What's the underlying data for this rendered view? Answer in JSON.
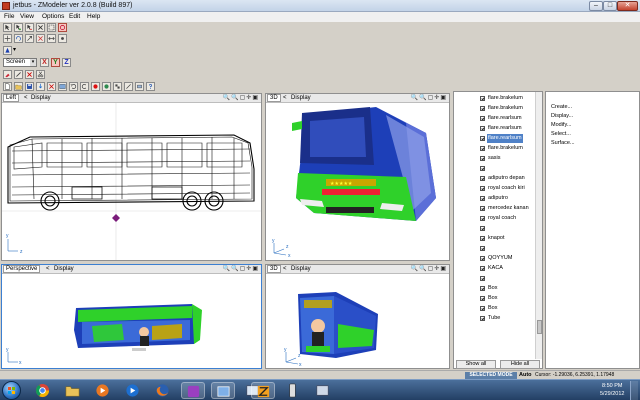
{
  "window": {
    "title": "jetbus - ZModeler ver 2.0.8 (Build 897)",
    "minimize": "–",
    "maximize": "□",
    "close": "✕"
  },
  "menu": [
    "File",
    "View",
    "Options",
    "Edit",
    "Help"
  ],
  "toolbar": {
    "screen_select": "Screen",
    "screen_arrow": "▾",
    "snap_arrow": "▾",
    "axis_labels": [
      "X",
      "Y",
      "Z"
    ]
  },
  "viewports": {
    "left": {
      "name": "Left",
      "mode": "Display",
      "tools": "🔍🔍▢✛▣"
    },
    "threed_top": {
      "name": "3D",
      "mode": "Display",
      "tools": "🔍🔍▢✛▣"
    },
    "perspective": {
      "name": "Perspective",
      "mode": "Display",
      "tools": "🔍🔍▢✛▣"
    },
    "threed_bottom": {
      "name": "3D",
      "mode": "Display",
      "tools": "🔍🔍▢✛▣"
    },
    "axes": {
      "y": "y",
      "z": "z",
      "x": "x"
    }
  },
  "objects": [
    {
      "label": "flare.brakelum"
    },
    {
      "label": "flare.brakelum"
    },
    {
      "label": "flare.rearlsum"
    },
    {
      "label": "flare.rearlsum"
    },
    {
      "label": "flare.rearlsum",
      "selected": true
    },
    {
      "label": "flare.brakelum"
    },
    {
      "label": "sasis"
    },
    {
      "label": ""
    },
    {
      "label": "adiputro depan"
    },
    {
      "label": "royal coach kiri"
    },
    {
      "label": "adiputro"
    },
    {
      "label": "mercedez kanan"
    },
    {
      "label": "royal coach"
    },
    {
      "label": ""
    },
    {
      "label": "knapot"
    },
    {
      "label": ""
    },
    {
      "label": "QOYYUM"
    },
    {
      "label": "KACA"
    },
    {
      "label": ""
    },
    {
      "label": "Box"
    },
    {
      "label": "Box"
    },
    {
      "label": "Box"
    },
    {
      "label": "Tube"
    }
  ],
  "object_panel": {
    "show_all": "Show all",
    "hide_all": "Hide all"
  },
  "commands": [
    "Create...",
    "Display...",
    "Modify...",
    "Select...",
    "Surface..."
  ],
  "statusbar": {
    "mode": "SELECTED MODE",
    "auto": "Auto",
    "cursor": "Cursor: -1.29036, 6.25391, 1.17948"
  },
  "taskbar": {
    "time": "8:50 PM",
    "date": "5/29/2012"
  },
  "colors": {
    "bus_body": "#2fd12a",
    "bus_glass": "#1d3fb8",
    "selection": "#4f81c7",
    "active_viewport": "#3c7fd1"
  }
}
